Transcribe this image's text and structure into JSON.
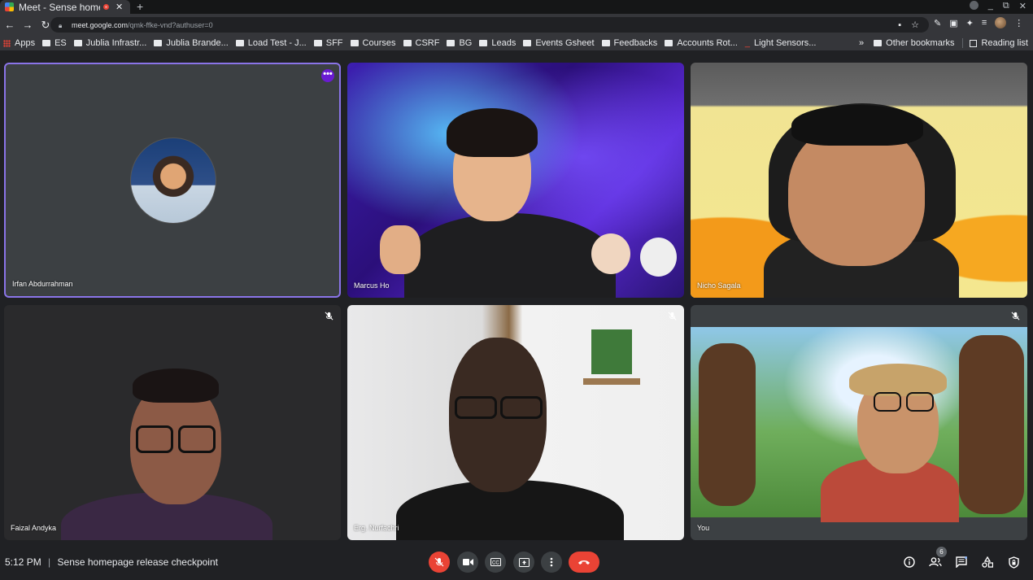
{
  "browser": {
    "tab": {
      "title": "Meet - Sense homep",
      "close": "✕"
    },
    "new_tab": "+",
    "url": {
      "host": "meet.google.com",
      "path": "/qmk-ffke-vnd?authuser=0"
    },
    "bookmarks": [
      {
        "label": "Apps",
        "kind": "apps"
      },
      {
        "label": "ES",
        "kind": "folder"
      },
      {
        "label": "Jublia Infrastr...",
        "kind": "folder"
      },
      {
        "label": "Jublia Brande...",
        "kind": "folder"
      },
      {
        "label": "Load Test - J...",
        "kind": "folder"
      },
      {
        "label": "SFF",
        "kind": "folder"
      },
      {
        "label": "Courses",
        "kind": "folder"
      },
      {
        "label": "CSRF",
        "kind": "folder"
      },
      {
        "label": "BG",
        "kind": "folder"
      },
      {
        "label": "Leads",
        "kind": "folder"
      },
      {
        "label": "Events Gsheet",
        "kind": "folder"
      },
      {
        "label": "Feedbacks",
        "kind": "folder"
      },
      {
        "label": "Accounts Rot...",
        "kind": "folder"
      },
      {
        "label": "Light Sensors...",
        "kind": "link"
      }
    ],
    "bookmarks_overflow": "»",
    "other_bookmarks": "Other bookmarks",
    "reading_list": "Reading list"
  },
  "meet": {
    "participants": [
      {
        "name": "Irfan Abdurrahman",
        "muted": false,
        "video": false
      },
      {
        "name": "Marcus Ho",
        "muted": false,
        "video": true
      },
      {
        "name": "Nicho Sagala",
        "muted": false,
        "video": true
      },
      {
        "name": "Faizal Andyka",
        "muted": true,
        "video": true
      },
      {
        "name": "Erg. Nurfachri",
        "muted": true,
        "video": true
      },
      {
        "name": "You",
        "muted": true,
        "video": true
      }
    ],
    "more_options": "•••",
    "bottom": {
      "time": "5:12 PM",
      "separator": "|",
      "meeting_title": "Sense homepage release checkpoint",
      "people_count": "6"
    }
  },
  "colors": {
    "accent_purple": "#8a74e8",
    "hangup_red": "#ea4335",
    "meet_bg": "#202124"
  }
}
